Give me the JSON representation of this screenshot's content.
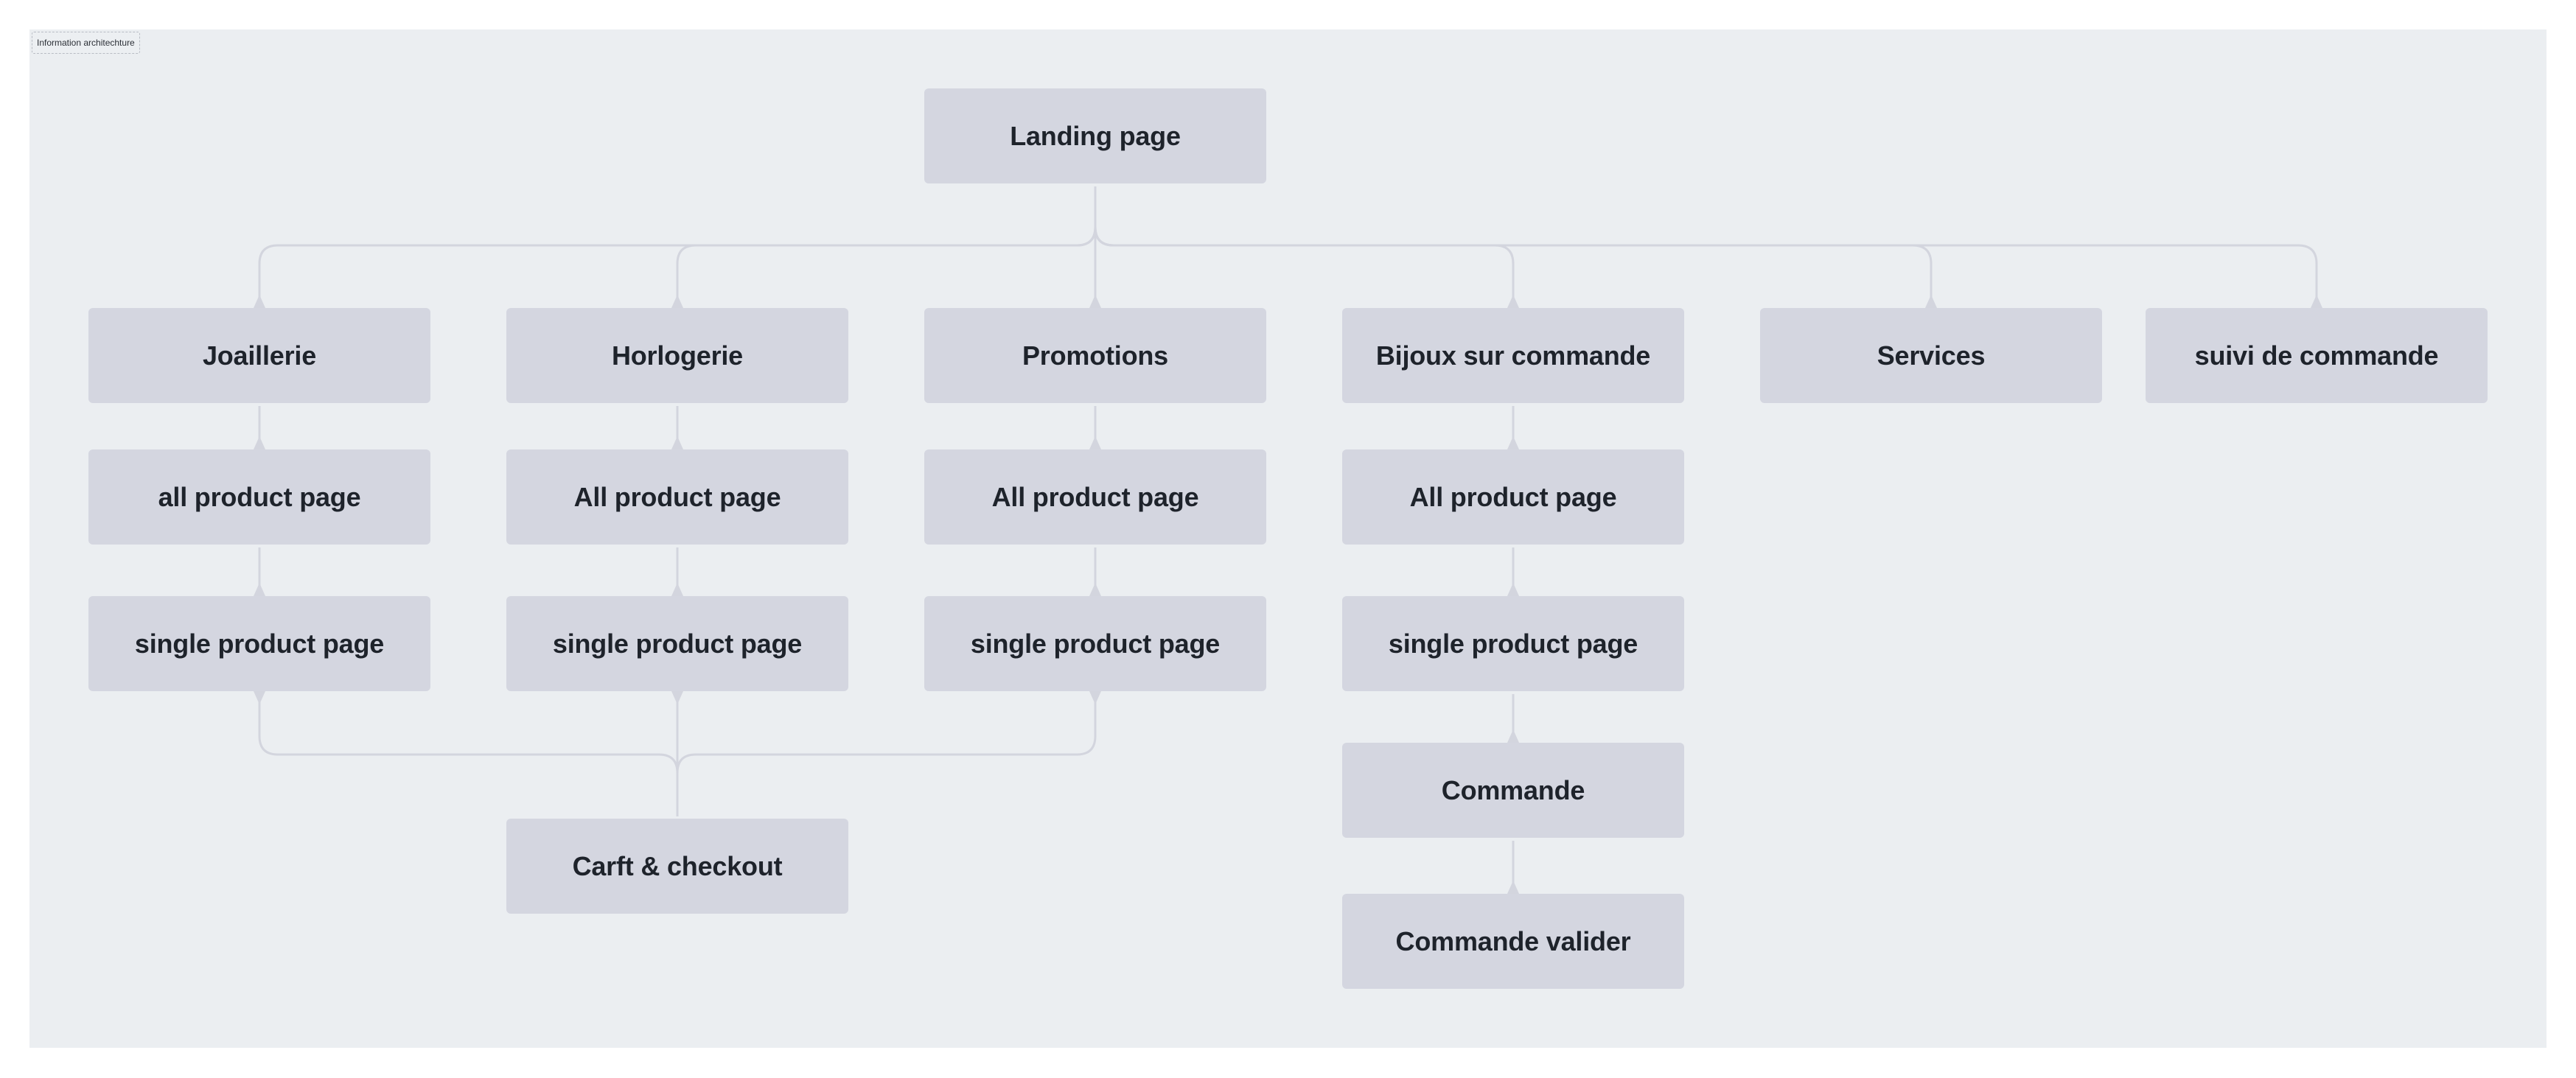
{
  "frame": {
    "label": "Information architechture"
  },
  "colors": {
    "background": "#ebeef1",
    "node": "#d4d6e0",
    "text": "#1e232b",
    "connector": "#d3d5de"
  },
  "nodes": [
    {
      "id": "landing",
      "label": "Landing page"
    },
    {
      "id": "joaillerie",
      "label": "Joaillerie"
    },
    {
      "id": "horlogerie",
      "label": "Horlogerie"
    },
    {
      "id": "promotions",
      "label": "Promotions"
    },
    {
      "id": "bijoux",
      "label": "Bijoux sur commande"
    },
    {
      "id": "services",
      "label": "Services"
    },
    {
      "id": "suivi",
      "label": "suivi de commande"
    },
    {
      "id": "joa_all",
      "label": "all product page"
    },
    {
      "id": "hor_all",
      "label": "All product page"
    },
    {
      "id": "pro_all",
      "label": "All product page"
    },
    {
      "id": "bij_all",
      "label": "All product page"
    },
    {
      "id": "joa_single",
      "label": "single product page"
    },
    {
      "id": "hor_single",
      "label": "single product page"
    },
    {
      "id": "pro_single",
      "label": "single product page"
    },
    {
      "id": "bij_single",
      "label": "single product page"
    },
    {
      "id": "cart",
      "label": "Carft & checkout"
    },
    {
      "id": "commande",
      "label": "Commande"
    },
    {
      "id": "commande_valider",
      "label": "Commande valider"
    }
  ],
  "edges": [
    {
      "from": "landing",
      "to": "joaillerie"
    },
    {
      "from": "landing",
      "to": "horlogerie"
    },
    {
      "from": "landing",
      "to": "promotions"
    },
    {
      "from": "landing",
      "to": "bijoux"
    },
    {
      "from": "landing",
      "to": "services"
    },
    {
      "from": "landing",
      "to": "suivi"
    },
    {
      "from": "joaillerie",
      "to": "joa_all"
    },
    {
      "from": "horlogerie",
      "to": "hor_all"
    },
    {
      "from": "promotions",
      "to": "pro_all"
    },
    {
      "from": "bijoux",
      "to": "bij_all"
    },
    {
      "from": "joa_all",
      "to": "joa_single"
    },
    {
      "from": "hor_all",
      "to": "hor_single"
    },
    {
      "from": "pro_all",
      "to": "pro_single"
    },
    {
      "from": "bij_all",
      "to": "bij_single"
    },
    {
      "from": "cart",
      "to": "joa_single"
    },
    {
      "from": "cart",
      "to": "hor_single"
    },
    {
      "from": "cart",
      "to": "pro_single"
    },
    {
      "from": "bij_single",
      "to": "commande"
    },
    {
      "from": "commande",
      "to": "commande_valider"
    }
  ]
}
